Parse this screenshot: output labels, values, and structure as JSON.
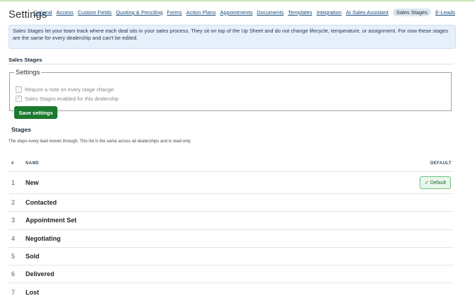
{
  "page": {
    "title": "Settings"
  },
  "nav": {
    "items": [
      {
        "label": "General"
      },
      {
        "label": "Access"
      },
      {
        "label": "Custom Fields"
      },
      {
        "label": "Quoting & Penciling"
      },
      {
        "label": "Forms"
      },
      {
        "label": "Action Plans"
      },
      {
        "label": "Appointments"
      },
      {
        "label": "Documents"
      },
      {
        "label": "Templates"
      },
      {
        "label": "Integration"
      },
      {
        "label": "AI Sales Assistant"
      },
      {
        "label": "Sales Stages",
        "active": true
      },
      {
        "label": "E-Leads"
      }
    ]
  },
  "info_banner": {
    "text": "Sales Stages let your team track where each deal sits in your sales process. They sit on top of the Up Sheet and do not change lifecycle, temperature, or assignment. For now these stages are the same for every dealership and can't be edited."
  },
  "section": {
    "title": "Sales Stages"
  },
  "settings": {
    "legend": "Settings",
    "options": [
      {
        "label": "Require a note on every stage change",
        "checked": false
      },
      {
        "label": "Sales Stages enabled for this dealership",
        "checked": true
      }
    ],
    "save_label": "Save settings"
  },
  "stages": {
    "title": "Stages",
    "description": "The steps every lead moves through. This list is the same across all dealerships and is read-only.",
    "headers": {
      "num": "#",
      "name": "NAME",
      "default": "DEFAULT"
    },
    "default_badge": "Default",
    "rows": [
      {
        "num": "1",
        "name": "New",
        "is_default": true
      },
      {
        "num": "2",
        "name": "Contacted"
      },
      {
        "num": "3",
        "name": "Appointment Set"
      },
      {
        "num": "4",
        "name": "Negotiating"
      },
      {
        "num": "5",
        "name": "Sold"
      },
      {
        "num": "6",
        "name": "Delivered"
      },
      {
        "num": "7",
        "name": "Lost"
      }
    ]
  },
  "colors": {
    "accent_green": "#1c7a2d",
    "banner_bg": "#e6f0fb",
    "link": "#1a4c7a"
  }
}
